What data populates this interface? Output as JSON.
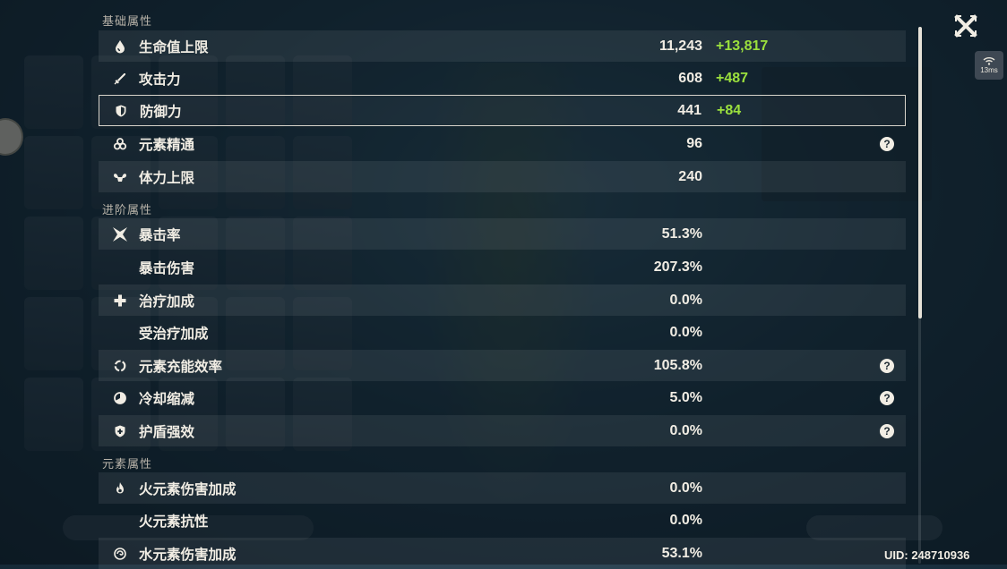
{
  "window": {
    "close_icon": "close-x-icon",
    "ping": "13ms",
    "uid": "UID: 248710936"
  },
  "sections": {
    "basic": "基础属性",
    "advanced": "进阶属性",
    "elemental": "元素属性"
  },
  "stats": [
    {
      "icon": "hp-drop-icon",
      "name": "生命值上限",
      "value": "11,243",
      "bonus": "+13,817"
    },
    {
      "icon": "sword-icon",
      "name": "攻击力",
      "value": "608",
      "bonus": "+487"
    },
    {
      "icon": "shield-icon",
      "name": "防御力",
      "value": "441",
      "bonus": "+84"
    },
    {
      "icon": "elemental-mastery-icon",
      "name": "元素精通",
      "value": "96",
      "bonus": ""
    },
    {
      "icon": "stamina-icon",
      "name": "体力上限",
      "value": "240",
      "bonus": ""
    },
    {
      "icon": "crit-rate-icon",
      "name": "暴击率",
      "value": "51.3%",
      "bonus": ""
    },
    {
      "icon": "",
      "name": "暴击伤害",
      "value": "207.3%",
      "bonus": ""
    },
    {
      "icon": "healing-cross-icon",
      "name": "治疗加成",
      "value": "0.0%",
      "bonus": ""
    },
    {
      "icon": "",
      "name": "受治疗加成",
      "value": "0.0%",
      "bonus": ""
    },
    {
      "icon": "energy-recharge-icon",
      "name": "元素充能效率",
      "value": "105.8%",
      "bonus": ""
    },
    {
      "icon": "cooldown-icon",
      "name": "冷却缩减",
      "value": "5.0%",
      "bonus": ""
    },
    {
      "icon": "shield-strength-icon",
      "name": "护盾强效",
      "value": "0.0%",
      "bonus": ""
    },
    {
      "icon": "pyro-icon",
      "name": "火元素伤害加成",
      "value": "0.0%",
      "bonus": ""
    },
    {
      "icon": "",
      "name": "火元素抗性",
      "value": "0.0%",
      "bonus": ""
    },
    {
      "icon": "hydro-icon",
      "name": "水元素伤害加成",
      "value": "53.1%",
      "bonus": ""
    }
  ],
  "help_icon": "question-mark-icon",
  "colors": {
    "bonus_green": "#9be03d",
    "text": "#f1ede4",
    "selected_border": "#d8d4cb"
  }
}
